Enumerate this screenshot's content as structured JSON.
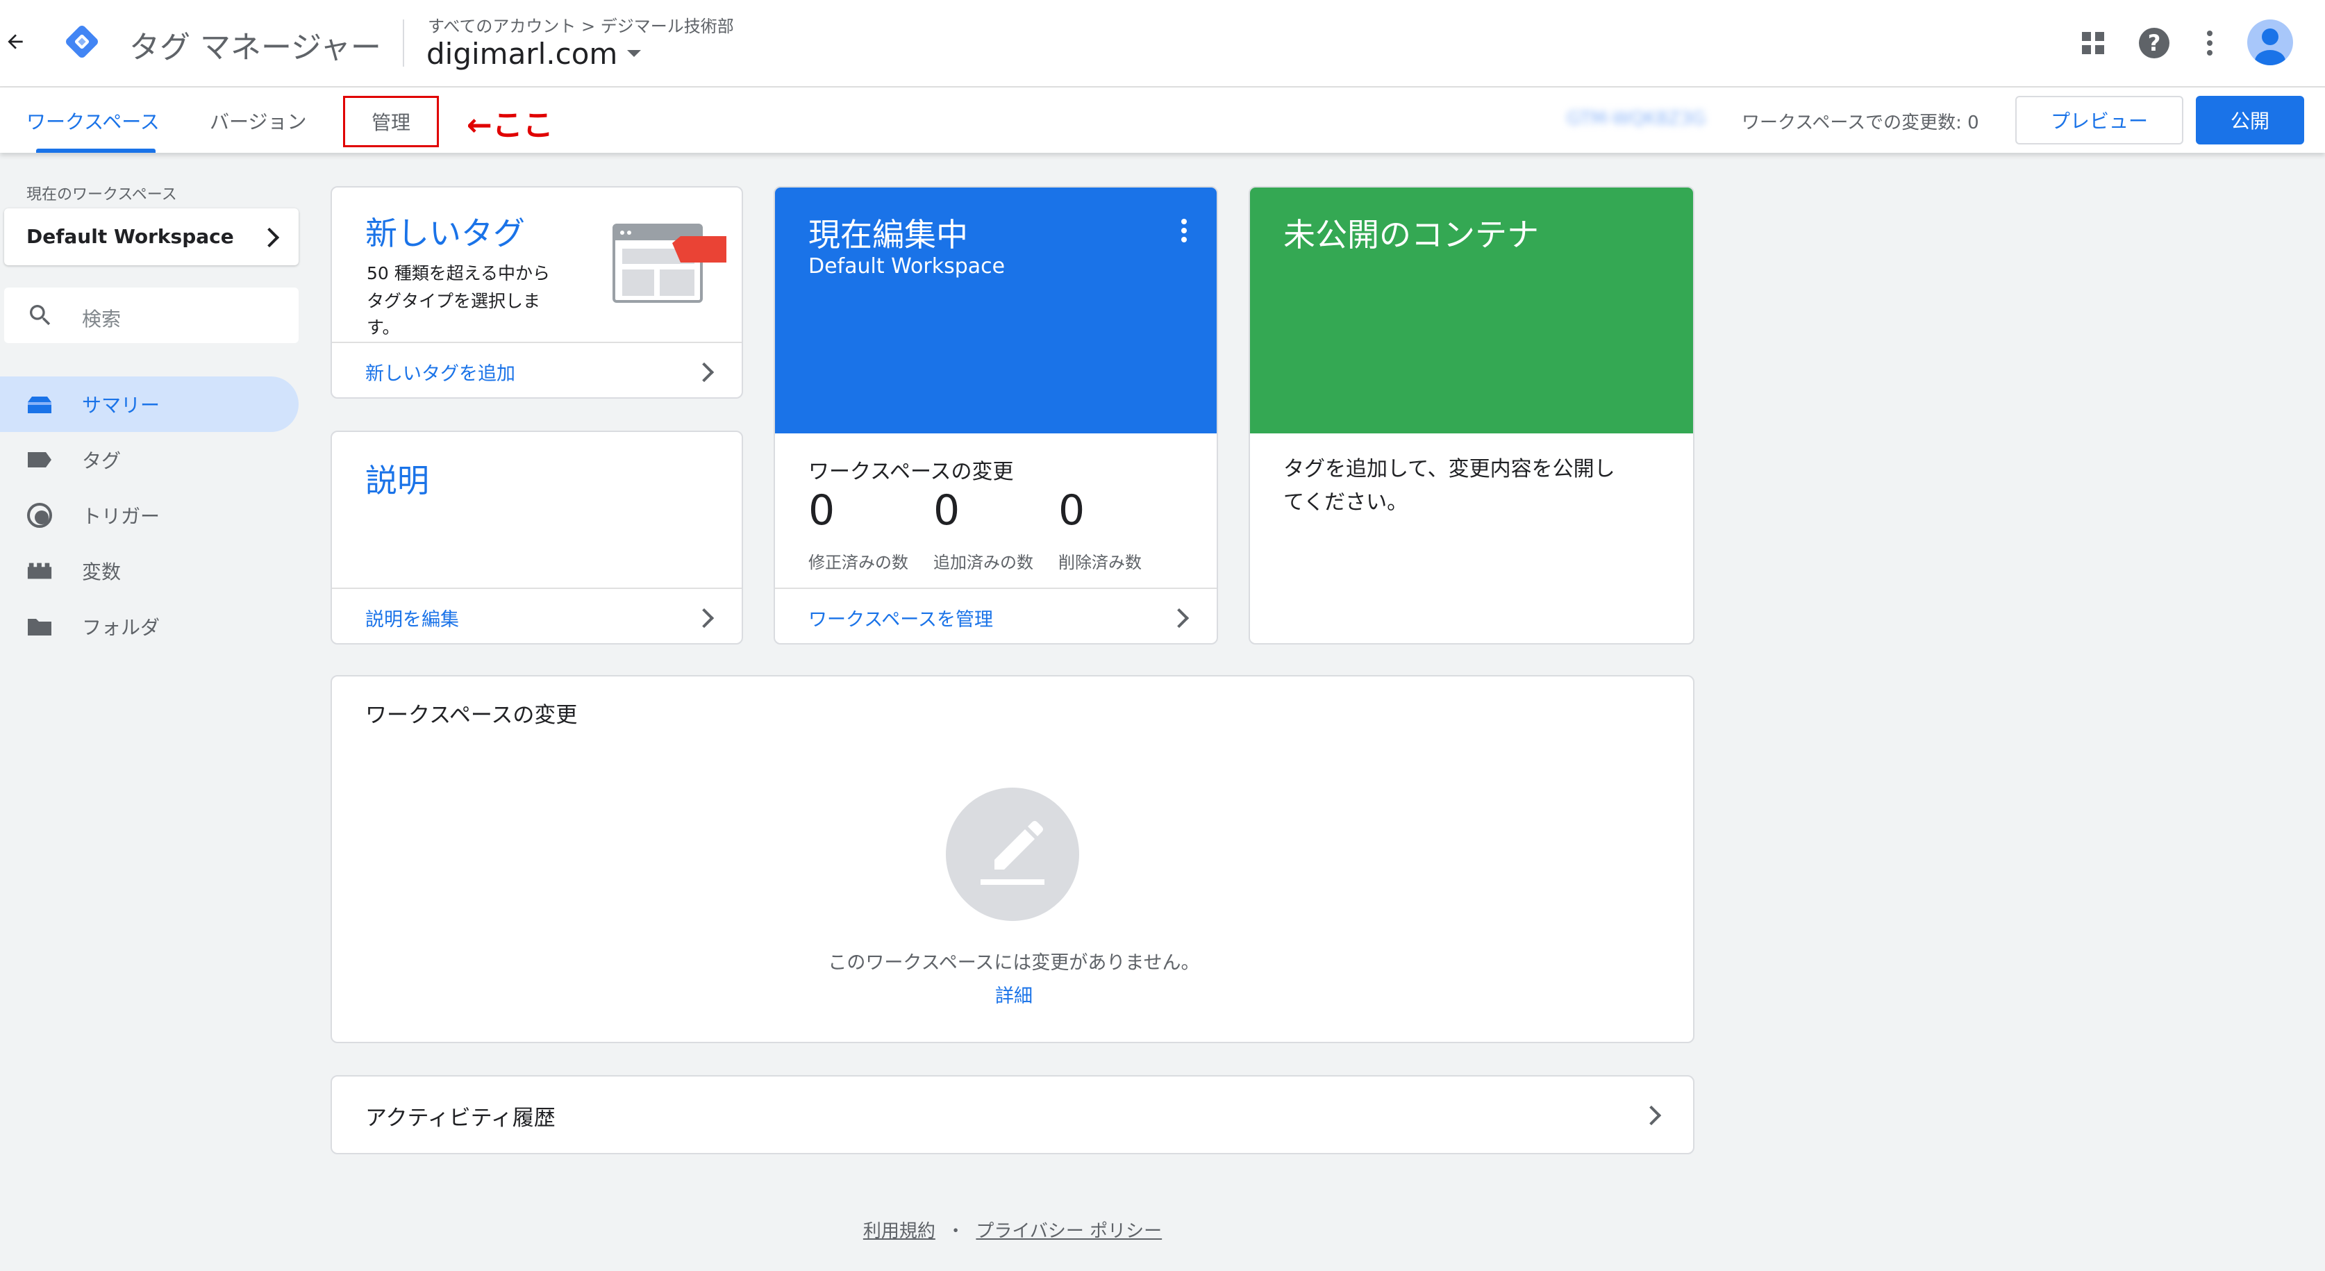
{
  "header": {
    "app_title": "タグ マネージャー",
    "breadcrumb": "すべてのアカウント > デジマール技術部",
    "container_name": "digimarl.com"
  },
  "subnav": {
    "tabs": [
      {
        "label": "ワークスペース",
        "active": true
      },
      {
        "label": "バージョン",
        "active": false
      },
      {
        "label": "管理",
        "active": false
      }
    ],
    "annotation": "←ここ",
    "container_id": "GTM-WQK8Z3G",
    "changes_text": "ワークスペースでの変更数: 0",
    "preview_label": "プレビュー",
    "publish_label": "公開"
  },
  "sidebar": {
    "workspace_caption": "現在のワークスペース",
    "workspace_name": "Default Workspace",
    "search_placeholder": "検索",
    "items": [
      {
        "label": "サマリー",
        "icon": "summary-icon",
        "active": true
      },
      {
        "label": "タグ",
        "icon": "tag-icon",
        "active": false
      },
      {
        "label": "トリガー",
        "icon": "trigger-icon",
        "active": false
      },
      {
        "label": "変数",
        "icon": "variable-icon",
        "active": false
      },
      {
        "label": "フォルダ",
        "icon": "folder-icon",
        "active": false
      }
    ]
  },
  "cards": {
    "new_tag": {
      "title": "新しいタグ",
      "desc_line1": "50 種類を超える中から",
      "desc_line2": "タグタイプを選択しま",
      "desc_line3": "す。",
      "link": "新しいタグを追加"
    },
    "description": {
      "title": "説明",
      "link": "説明を編集"
    },
    "editing": {
      "title": "現在編集中",
      "workspace": "Default Workspace",
      "changes_heading": "ワークスペースの変更",
      "modified_count": "0",
      "added_count": "0",
      "deleted_count": "0",
      "modified_label": "修正済みの数",
      "added_label": "追加済みの数",
      "deleted_label": "削除済み数",
      "link": "ワークスペースを管理"
    },
    "unpublished": {
      "title": "未公開のコンテナ",
      "body_line1": "タグを追加して、変更内容を公開し",
      "body_line2": "てください。"
    },
    "workspace_changes": {
      "title": "ワークスペースの変更",
      "empty_text": "このワークスペースには変更がありません。",
      "details_link": "詳細"
    },
    "activity": {
      "title": "アクティビティ履歴"
    }
  },
  "footer": {
    "terms": "利用規約",
    "separator": "・",
    "privacy": "プライバシー ポリシー"
  },
  "colors": {
    "accent_blue": "#1a73e8",
    "green": "#34a853",
    "annotation_red": "#e00000",
    "tag_red": "#ea4335"
  }
}
